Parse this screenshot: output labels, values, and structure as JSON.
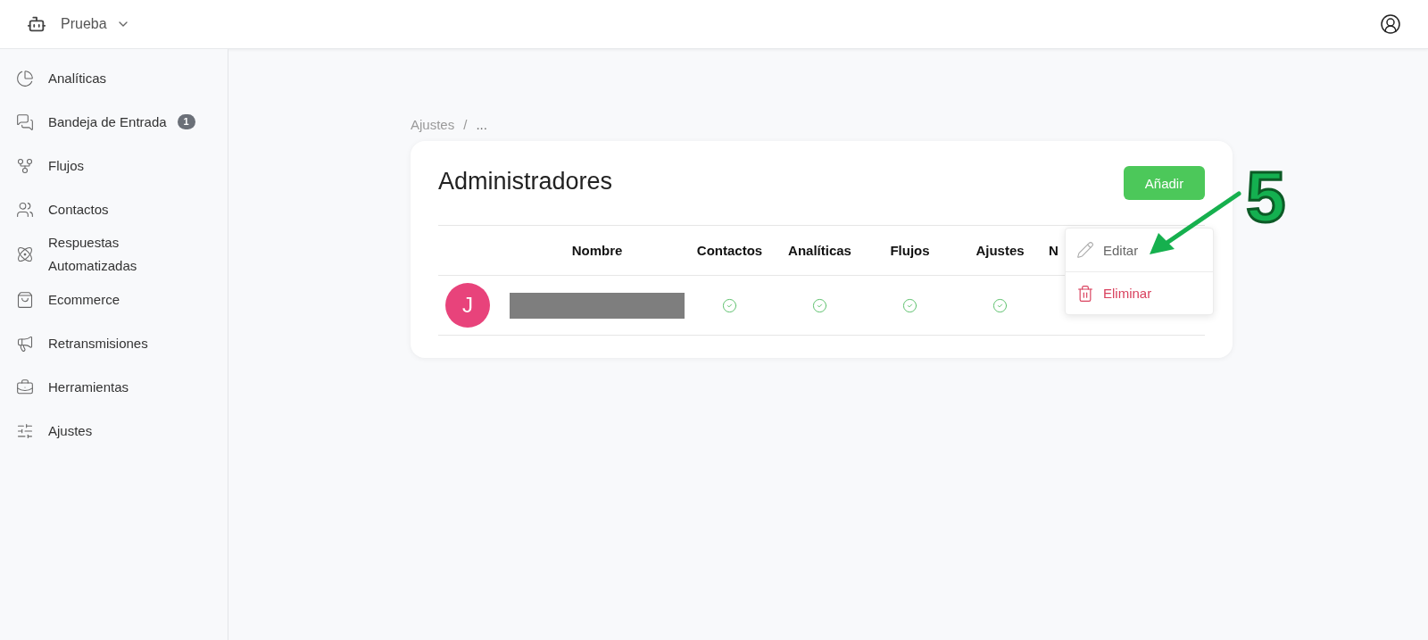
{
  "topbar": {
    "workspace": "Prueba"
  },
  "sidebar": {
    "items": [
      {
        "label": "Analíticas"
      },
      {
        "label": "Bandeja de Entrada",
        "badge": "1"
      },
      {
        "label": "Flujos"
      },
      {
        "label": "Contactos"
      },
      {
        "label": "Respuestas Automatizadas"
      },
      {
        "label": "Ecommerce"
      },
      {
        "label": "Retransmisiones"
      },
      {
        "label": "Herramientas"
      },
      {
        "label": "Ajustes"
      }
    ]
  },
  "breadcrumb": {
    "separator": "/",
    "items": [
      "Ajustes",
      "..."
    ]
  },
  "card": {
    "title": "Administradores",
    "add_button": "Añadir",
    "table": {
      "columns": [
        "Nombre",
        "Contactos",
        "Analíticas",
        "Flujos",
        "Ajustes",
        "N"
      ],
      "rows": [
        {
          "avatar": "J",
          "name_redacted": true,
          "permissions": [
            {
              "granted": true
            },
            {
              "granted": true
            },
            {
              "granted": true
            },
            {
              "granted": true
            }
          ]
        }
      ]
    }
  },
  "context_menu": {
    "items": [
      {
        "kind": "edit",
        "label": "Editar"
      },
      {
        "kind": "delete",
        "label": "Eliminar"
      }
    ]
  },
  "annotation": {
    "label": "5"
  }
}
